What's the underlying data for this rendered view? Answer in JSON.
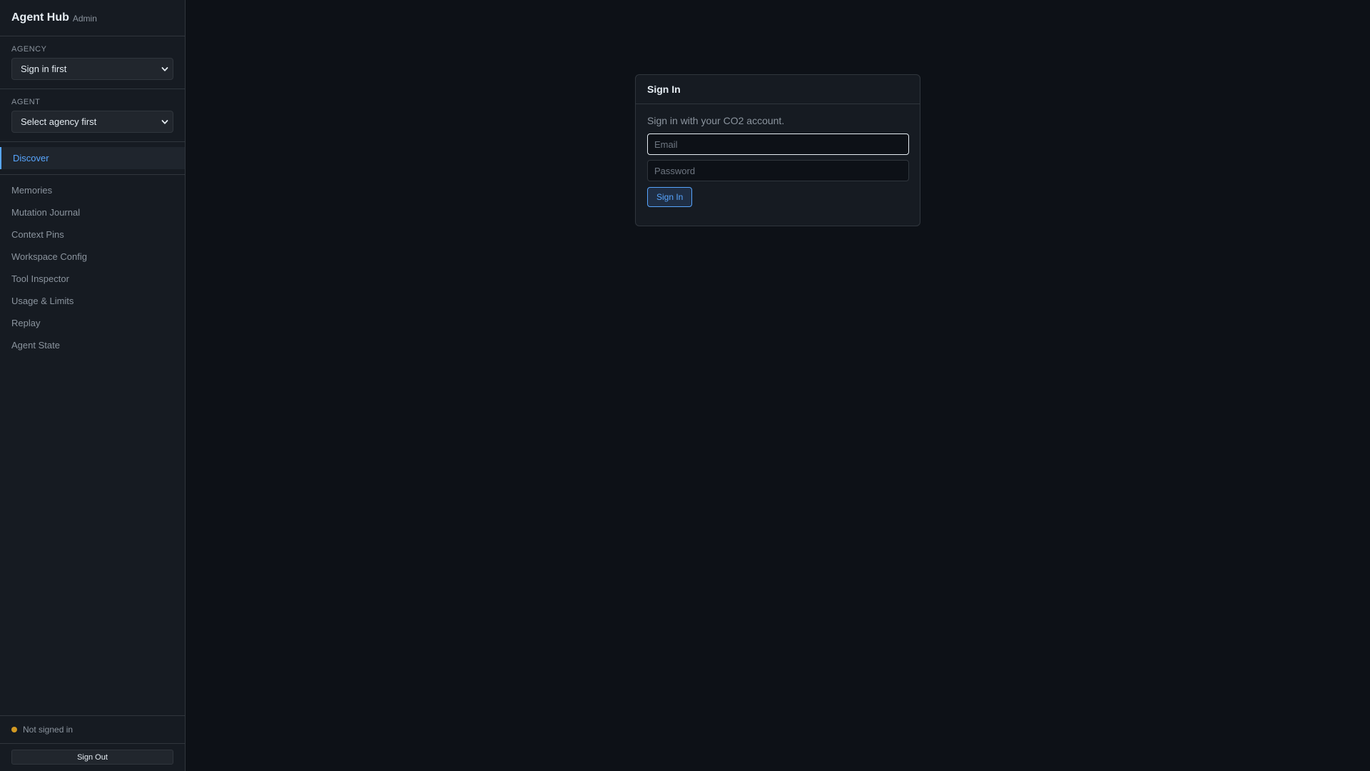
{
  "brand": {
    "title": "Agent Hub",
    "subtitle": "Admin"
  },
  "agency": {
    "label": "AGENCY",
    "selected": "Sign in first"
  },
  "agent": {
    "label": "AGENT",
    "selected": "Select agency first"
  },
  "nav": {
    "active": "Discover",
    "items": [
      "Memories",
      "Mutation Journal",
      "Context Pins",
      "Workspace Config",
      "Tool Inspector",
      "Usage & Limits",
      "Replay",
      "Agent State"
    ]
  },
  "status": {
    "text": "Not signed in",
    "color": "#d29922"
  },
  "signout": {
    "label": "Sign Out"
  },
  "signin": {
    "title": "Sign In",
    "description": "Sign in with your CO2 account.",
    "email_placeholder": "Email",
    "password_placeholder": "Password",
    "button_label": "Sign In"
  },
  "colors": {
    "accent": "#58a6ff",
    "background": "#0d1117",
    "panel": "#161b22"
  }
}
